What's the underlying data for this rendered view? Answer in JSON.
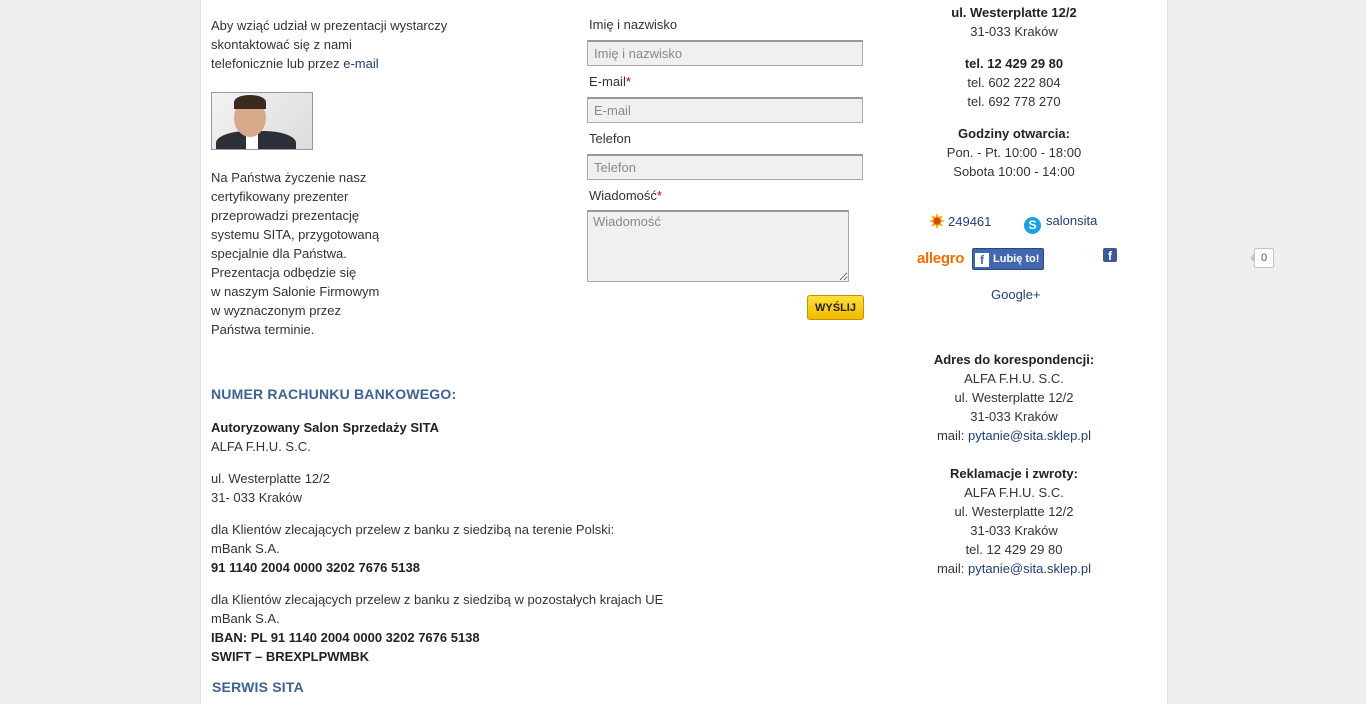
{
  "left": {
    "intro_lines": [
      "Aby wziąć udział w prezentacji wystarczy",
      "skontaktować się z nami"
    ],
    "intro_line3_prefix": "telefonicznie lub przez ",
    "intro_link": "e-mail",
    "offer_lines": [
      "Na Państwa życzenie nasz",
      "certyfikowany prezenter",
      "przeprowadzi prezentację",
      "systemu SITA, przygotowaną",
      "specjalnie dla Państwa.",
      "Prezentacja odbędzie się",
      "w naszym Salonie Firmowym",
      "w wyznaczonym przez",
      "Państwa terminie."
    ]
  },
  "form": {
    "name_label": "Imię i nazwisko",
    "name_placeholder": "Imię i nazwisko",
    "email_label": "E-mail",
    "email_placeholder": "E-mail",
    "phone_label": "Telefon",
    "phone_placeholder": "Telefon",
    "message_label": "Wiadomość",
    "message_placeholder": "Wiadomość",
    "required_mark": "*",
    "send_label": "WYŚLIJ"
  },
  "bank": {
    "heading": "NUMER RACHUNKU BANKOWEGO:",
    "company_name": "Autoryzowany Salon Sprzedaży SITA",
    "company_sub": "ALFA F.H.U. S.C.",
    "street": "ul. Westerplatte 12/2",
    "city": "31- 033 Kraków",
    "pl_note": "dla Klientów zlecających przelew z banku z siedzibą na terenie Polski:",
    "pl_bank": "mBank S.A.",
    "pl_account": "91 1140 2004 0000 3202 7676 5138",
    "eu_note": "dla Klientów zlecających przelew z banku z siedzibą w pozostałych krajach UE",
    "eu_bank": "mBank S.A.",
    "eu_iban": "IBAN: PL 91 1140 2004 0000 3202 7676 5138",
    "eu_swift": "SWIFT – BREXPLPWMBK",
    "service_heading": "SERWIS SITA"
  },
  "contact": {
    "street": "ul. Westerplatte 12/2",
    "city": "31-033 Kraków",
    "tel_main": "tel. 12 429 29 80",
    "tel2": "tel. 602 222 804",
    "tel3": "tel. 692 778 270",
    "hours_heading": "Godziny otwarcia:",
    "hours_weekdays": "Pon. - Pt. 10:00 - 18:00",
    "hours_saturday": "Sobota 10:00 - 14:00",
    "gg_number": "249461",
    "skype_name": "salonsita",
    "allegro_label": "allegro",
    "fb_like_label": "Lubię to!",
    "fb_like_count": "0",
    "google_plus": "Google+",
    "corr_heading": "Adres do korespondencji:",
    "corr_company": "ALFA F.H.U. S.C.",
    "corr_street": "ul. Westerplatte 12/2",
    "corr_city": "31-033 Kraków",
    "corr_mail_prefix": "mail: ",
    "corr_mail": "pytanie@sita.sklep.pl",
    "ret_heading": "Reklamacje i zwroty:",
    "ret_company": "ALFA F.H.U. S.C.",
    "ret_street": "ul. Westerplatte 12/2",
    "ret_city": "31-033 Kraków",
    "ret_tel": "tel. 12 429 29 80",
    "ret_mail_prefix": "mail: ",
    "ret_mail": "pytanie@sita.sklep.pl"
  },
  "colors": {
    "heading": "#3d6294",
    "link": "#1f3e7a",
    "button": "#f2b900",
    "facebook": "#4267b2",
    "allegro": "#f46d00"
  },
  "icons": [
    "gadu-gadu-icon",
    "skype-icon",
    "facebook-icon"
  ]
}
